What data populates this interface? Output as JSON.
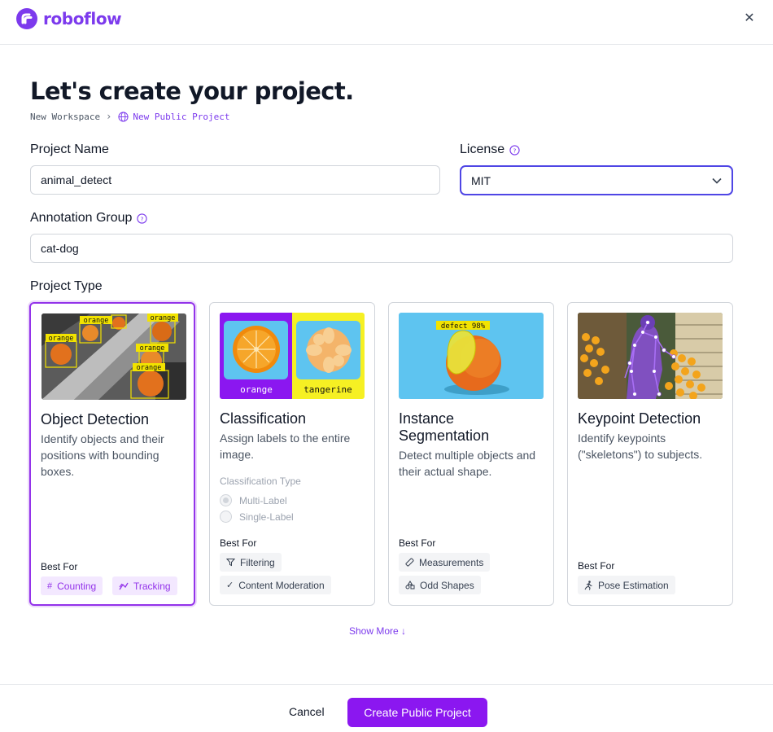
{
  "app": {
    "name": "roboflow"
  },
  "page": {
    "title": "Let's create your project."
  },
  "breadcrumb": {
    "items": [
      "New Workspace",
      "New Public Project"
    ]
  },
  "form": {
    "project_name": {
      "label": "Project Name",
      "value": "animal_detect"
    },
    "license": {
      "label": "License",
      "value": "MIT"
    },
    "annotation_group": {
      "label": "Annotation Group",
      "value": "cat-dog"
    },
    "project_type_label": "Project Type"
  },
  "cards": [
    {
      "title": "Object Detection",
      "description": "Identify objects and their positions with bounding boxes.",
      "best_for": "Best For",
      "tags": [
        "Counting",
        "Tracking"
      ],
      "thumb_labels": [
        "orange",
        "orange",
        "orange",
        "orange",
        "orange",
        "orange"
      ]
    },
    {
      "title": "Classification",
      "description": "Assign labels to the entire image.",
      "subsection": "Classification Type",
      "options": [
        "Multi-Label",
        "Single-Label"
      ],
      "best_for": "Best For",
      "tags": [
        "Filtering",
        "Content Moderation"
      ],
      "thumb_labels": [
        "orange",
        "tangerine"
      ]
    },
    {
      "title": "Instance Segmentation",
      "description": "Detect multiple objects and their actual shape.",
      "best_for": "Best For",
      "tags": [
        "Measurements",
        "Odd Shapes"
      ],
      "thumb_labels": [
        "defect 98%"
      ]
    },
    {
      "title": "Keypoint Detection",
      "description": "Identify keypoints (\"skeletons\") to subjects.",
      "best_for": "Best For",
      "tags": [
        "Pose Estimation"
      ]
    }
  ],
  "show_more": "Show More ↓",
  "footer": {
    "cancel": "Cancel",
    "submit": "Create Public Project"
  },
  "colors": {
    "accent": "#8b17f0",
    "brand": "#7c3aed",
    "focus_border": "#4f46e5"
  }
}
